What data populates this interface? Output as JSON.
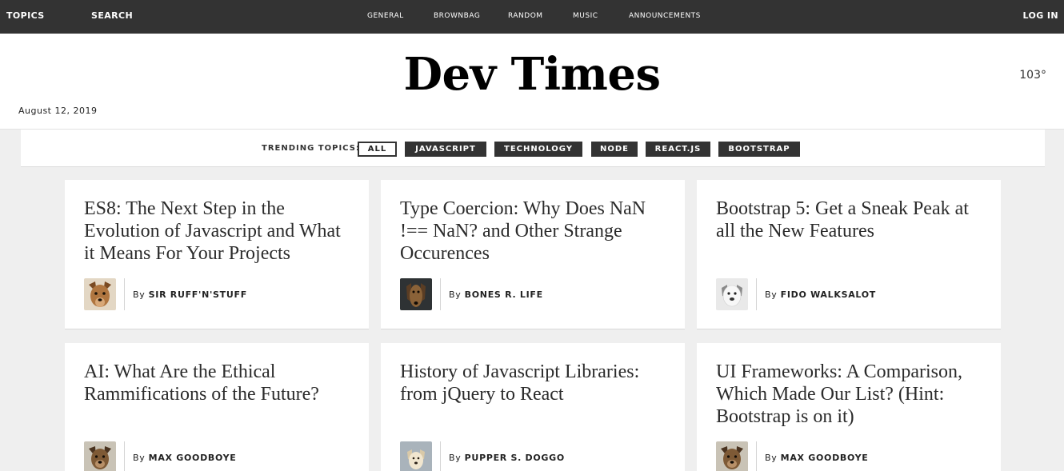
{
  "nav": {
    "topics": "TOPICS",
    "search": "SEARCH",
    "sections": [
      "GENERAL",
      "BROWNBAG",
      "RANDOM",
      "MUSIC",
      "ANNOUNCEMENTS"
    ],
    "login": "LOG IN"
  },
  "masthead": {
    "title": "Dev Times",
    "date": "August 12, 2019",
    "temperature": "103°"
  },
  "trending": {
    "label": "TRENDING TOPICS:",
    "tags": [
      "ALL",
      "JAVASCRIPT",
      "TECHNOLOGY",
      "NODE",
      "REACT.JS",
      "BOOTSTRAP"
    ],
    "active": "ALL"
  },
  "articles": [
    {
      "title": "ES8: The Next Step in the Evolution of Javascript and What it Means For Your Projects",
      "by": "By",
      "author": "SIR RUFF'N'STUFF"
    },
    {
      "title": "Type Coercion: Why Does NaN !== NaN? and Other Strange Occurences",
      "by": "By",
      "author": "BONES R. LIFE"
    },
    {
      "title": "Bootstrap 5: Get a Sneak Peak at all the New Features",
      "by": "By",
      "author": "FIDO WALKSALOT"
    },
    {
      "title": "AI: What Are the Ethical Rammifications of the Future?",
      "by": "By",
      "author": "MAX GOODBOYE"
    },
    {
      "title": "History of Javascript Libraries: from jQuery to React",
      "by": "By",
      "author": "PUPPER S. DOGGO"
    },
    {
      "title": "UI Frameworks: A Comparison, Which Made Our List? (Hint: Bootstrap is on it)",
      "by": "By",
      "author": "MAX GOODBOYE"
    }
  ],
  "colors": {
    "nav_bg": "#333333",
    "tag_bg": "#333333",
    "page_bg": "#efefef"
  }
}
